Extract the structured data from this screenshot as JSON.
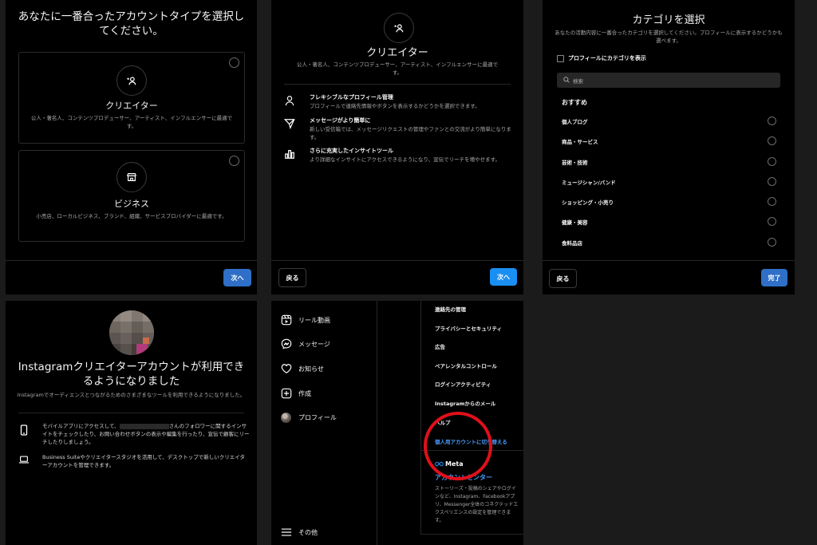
{
  "panel1": {
    "title": "あなたに一番合ったアカウントタイプを選択してください。",
    "creator": {
      "label": "クリエイター",
      "desc": "公人・著名人、コンテンツプロデューサー、アーティスト、インフルエンサーに最適です。"
    },
    "business": {
      "label": "ビジネス",
      "desc": "小売店、ローカルビジネス、ブランド、組織、サービスプロバイダーに最適です。"
    },
    "next_label": "次へ"
  },
  "panel2": {
    "title": "クリエイター",
    "subtitle": "公人・著名人、コンテンツプロデューサー、アーティスト、インフルエンサーに最適です。",
    "features": [
      {
        "icon": "person-icon",
        "title": "フレキシブルなプロフィール管理",
        "desc": "プロフィールで連絡先情報やボタンを表示するかどうかを選択できます。"
      },
      {
        "icon": "send-icon",
        "title": "メッセージがより簡単に",
        "desc": "新しい受信箱では、メッセージリクエストの管理やファンとの交流がより簡単になります。"
      },
      {
        "icon": "chart-icon",
        "title": "さらに充実したインサイトツール",
        "desc": "より詳細なインサイトにアクセスできるようになり、宣伝でリーチを増やせます。"
      }
    ],
    "back_label": "戻る",
    "next_label": "次へ"
  },
  "panel3": {
    "title": "カテゴリを選択",
    "subtitle": "あなたの活動内容に一番合ったカテゴリを選択してください。プロフィールに表示するかどうかも選べます。",
    "show_category_label": "プロフィールにカテゴリを表示",
    "search_placeholder": "検索",
    "recommended_label": "おすすめ",
    "categories": [
      "個人ブログ",
      "商品・サービス",
      "芸術・技術",
      "ミュージシャン/バンド",
      "ショッピング・小売り",
      "健康・美容",
      "食料品店"
    ],
    "back_label": "戻る",
    "done_label": "完了"
  },
  "panel4": {
    "title": "Instagramクリエイターアカウントが利用できるようになりました",
    "subtitle": "Instagramでオーディエンスとつながるためのさまざまなツールを利用できるようになりました。",
    "items": [
      {
        "icon": "phone-icon",
        "text_a": "モバイルアプリにアクセスして、",
        "text_b": "さんのフォロワーに関するインサイトをチェックしたり、お問い合わせボタンの表示や編集を行ったり、宣伝で顧客にリーチしたりしましょう。"
      },
      {
        "icon": "laptop-icon",
        "text": "Business Suiteやクリエイタースタジオを活用して、デスクトップで新しいクリエイターアカウントを管理できます。"
      }
    ]
  },
  "panel5": {
    "nav": [
      {
        "icon": "reels-icon",
        "label": "リール動画"
      },
      {
        "icon": "messenger-icon",
        "label": "メッセージ"
      },
      {
        "icon": "heart-icon",
        "label": "お知らせ"
      },
      {
        "icon": "plus-square-icon",
        "label": "作成"
      },
      {
        "icon": "avatar",
        "label": "プロフィール"
      }
    ],
    "more_label": "その他",
    "settings_items": [
      "連絡先の管理",
      "プライバシーとセキュリティ",
      "広告",
      "ペアレンタルコントロール",
      "ログインアクティビティ",
      "Instagramからのメール",
      "ヘルプ"
    ],
    "switch_label": "個人用アカウントに切り替える",
    "meta_logo": "Meta",
    "accounts_center_label": "アカウントセンター",
    "accounts_center_desc": "ストーリーズ・投稿のシェアやログインなど、Instagram、Facebookアプリ、Messenger全体のコネクテッドエクスペリエンスの設定を管理できます。",
    "annotation_color": "#e0101a"
  },
  "colors": {
    "accent": "#2f6fc7",
    "accent_bright": "#1a8ff2",
    "link": "#4a9eff",
    "highlight": "#e0101a"
  }
}
